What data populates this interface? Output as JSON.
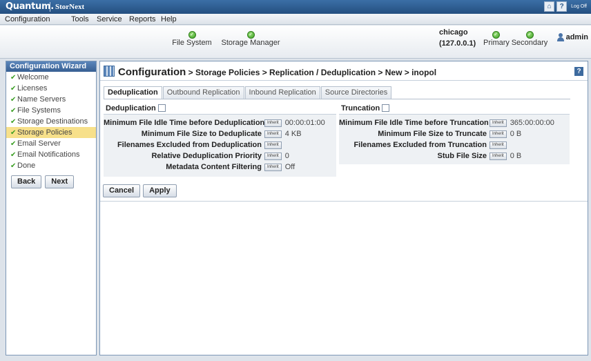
{
  "header": {
    "brand": "Quantum.",
    "product": "StorNext",
    "logoff_label": "Log Off"
  },
  "menu": [
    "Configuration",
    "Tools",
    "Service",
    "Reports",
    "Help"
  ],
  "status": {
    "file_system_label": "File System",
    "storage_manager_label": "Storage Manager",
    "host_name": "chicago",
    "host_ip": "(127.0.0.1)",
    "primary_label": "Primary",
    "secondary_label": "Secondary",
    "user": "admin"
  },
  "wizard": {
    "title": "Configuration Wizard",
    "items": [
      {
        "label": "Welcome",
        "active": false
      },
      {
        "label": "Licenses",
        "active": false
      },
      {
        "label": "Name Servers",
        "active": false
      },
      {
        "label": "File Systems",
        "active": false
      },
      {
        "label": "Storage Destinations",
        "active": false
      },
      {
        "label": "Storage Policies",
        "active": true
      },
      {
        "label": "Email Server",
        "active": false
      },
      {
        "label": "Email Notifications",
        "active": false
      },
      {
        "label": "Done",
        "active": false
      }
    ],
    "back_label": "Back",
    "next_label": "Next"
  },
  "breadcrumb": {
    "root": "Configuration",
    "rest": " > Storage Policies > Replication / Deduplication > New > inopol"
  },
  "tabs": [
    "Deduplication",
    "Outbound Replication",
    "Inbound Replication",
    "Source Directories"
  ],
  "dedup": {
    "title": "Deduplication",
    "checked": false,
    "rows": [
      {
        "label": "Minimum File Idle Time before Deduplication",
        "value": "00:00:01:00"
      },
      {
        "label": "Minimum File Size to Deduplicate",
        "value": "4 KB"
      },
      {
        "label": "Filenames Excluded from Deduplication",
        "value": ""
      },
      {
        "label": "Relative Deduplication Priority",
        "value": "0"
      },
      {
        "label": "Metadata Content Filtering",
        "value": "Off"
      }
    ]
  },
  "truncation": {
    "title": "Truncation",
    "checked": false,
    "rows": [
      {
        "label": "Minimum File Idle Time before Truncation",
        "value": "365:00:00:00"
      },
      {
        "label": "Minimum File Size to Truncate",
        "value": "0 B"
      },
      {
        "label": "Filenames Excluded from Truncation",
        "value": ""
      },
      {
        "label": "Stub File Size",
        "value": "0 B"
      }
    ]
  },
  "inherit_label": "Inherit",
  "actions": {
    "cancel": "Cancel",
    "apply": "Apply"
  }
}
